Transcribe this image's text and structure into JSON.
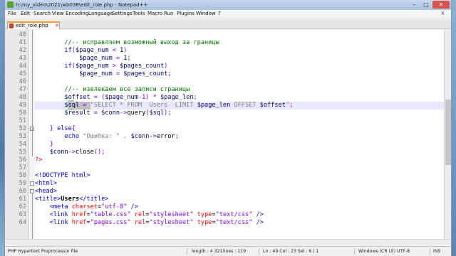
{
  "window": {
    "title": "h:\\my_video\\2021\\wb038\\edit_role.php - Notepad++",
    "controls": {
      "minimize": "–",
      "maximize": "□",
      "close": "✕"
    }
  },
  "menubar": {
    "items": [
      "File",
      "Edit",
      "Search",
      "View",
      "Encoding",
      "Language",
      "Settings",
      "Tools",
      "Macro",
      "Run",
      "Plugins",
      "Window",
      "?"
    ],
    "close_doc": "X"
  },
  "tabs": [
    {
      "label": "edit_role.php",
      "close": "✕",
      "active": true
    }
  ],
  "editor": {
    "lines": [
      {
        "n": "40",
        "tokens": []
      },
      {
        "n": "41",
        "tokens": [
          {
            "t": "        "
          },
          {
            "t": "//-- исправляем возможный выход за границы",
            "c": "cm"
          }
        ]
      },
      {
        "n": "42",
        "tokens": [
          {
            "t": "        "
          },
          {
            "t": "if",
            "c": "kw"
          },
          {
            "t": "(",
            "c": "op"
          },
          {
            "t": "$page_num",
            "c": "var"
          },
          {
            "t": " < ",
            "c": "op"
          },
          {
            "t": "1",
            "c": "fn"
          },
          {
            "t": ")",
            "c": "op"
          }
        ]
      },
      {
        "n": "43",
        "tokens": [
          {
            "t": "            "
          },
          {
            "t": "$page_num",
            "c": "var"
          },
          {
            "t": " = ",
            "c": "op"
          },
          {
            "t": "1",
            "c": "fn"
          },
          {
            "t": ";",
            "c": "op"
          }
        ]
      },
      {
        "n": "44",
        "tokens": [
          {
            "t": "        "
          },
          {
            "t": "if",
            "c": "kw"
          },
          {
            "t": "(",
            "c": "op"
          },
          {
            "t": "$page_num",
            "c": "var"
          },
          {
            "t": " > ",
            "c": "op"
          },
          {
            "t": "$pages_count",
            "c": "var"
          },
          {
            "t": ")",
            "c": "op"
          }
        ]
      },
      {
        "n": "45",
        "tokens": [
          {
            "t": "            "
          },
          {
            "t": "$page_num",
            "c": "var"
          },
          {
            "t": " = ",
            "c": "op"
          },
          {
            "t": "$pages_count",
            "c": "var"
          },
          {
            "t": ";",
            "c": "op"
          }
        ]
      },
      {
        "n": "46",
        "tokens": []
      },
      {
        "n": "47",
        "tokens": [
          {
            "t": "        "
          },
          {
            "t": "//-- извлекаем все записи страницы",
            "c": "cm"
          }
        ]
      },
      {
        "n": "48",
        "tokens": [
          {
            "t": "        "
          },
          {
            "t": "$offset",
            "c": "var"
          },
          {
            "t": " = (",
            "c": "op"
          },
          {
            "t": "$page_num",
            "c": "var"
          },
          {
            "t": "-1) * ",
            "c": "op"
          },
          {
            "t": "$page_len",
            "c": "var"
          },
          {
            "t": ";",
            "c": "op"
          }
        ]
      },
      {
        "n": "49",
        "tokens": [
          {
            "t": "        "
          },
          {
            "t": "$sql",
            "c": "var"
          },
          {
            "t": " = ",
            "c": "op"
          },
          {
            "t": "\"SELECT * FROM  Users  LIMIT ",
            "c": "str"
          },
          {
            "t": "$page_len",
            "c": "var"
          },
          {
            "t": " OFFSET ",
            "c": "str"
          },
          {
            "t": "$offset",
            "c": "var"
          },
          {
            "t": "\"",
            "c": "str"
          },
          {
            "t": ";",
            "c": "op"
          }
        ]
      },
      {
        "n": "50",
        "tokens": [
          {
            "t": "        "
          },
          {
            "t": "$result",
            "c": "var"
          },
          {
            "t": " = ",
            "c": "op"
          },
          {
            "t": "$conn",
            "c": "var"
          },
          {
            "t": "->",
            "c": "op"
          },
          {
            "t": "query",
            "c": "fn"
          },
          {
            "t": "(",
            "c": "op"
          },
          {
            "t": "$sql",
            "c": "var"
          },
          {
            "t": ");",
            "c": "op"
          }
        ]
      },
      {
        "n": "51",
        "tokens": []
      },
      {
        "n": "52",
        "tokens": [
          {
            "t": "    "
          },
          {
            "t": "} ",
            "c": "op"
          },
          {
            "t": "else",
            "c": "kw"
          },
          {
            "t": "{",
            "c": "op"
          }
        ]
      },
      {
        "n": "53",
        "tokens": [
          {
            "t": "        "
          },
          {
            "t": "echo",
            "c": "kw"
          },
          {
            "t": " ",
            "c": "op"
          },
          {
            "t": "\"Ошибка: \"",
            "c": "str"
          },
          {
            "t": " . ",
            "c": "op"
          },
          {
            "t": "$conn",
            "c": "var"
          },
          {
            "t": "->",
            "c": "op"
          },
          {
            "t": "error",
            "c": "fn"
          },
          {
            "t": ";",
            "c": "op"
          }
        ]
      },
      {
        "n": "54",
        "tokens": [
          {
            "t": "    "
          },
          {
            "t": "}",
            "c": "op"
          }
        ]
      },
      {
        "n": "55",
        "tokens": [
          {
            "t": "    "
          },
          {
            "t": "$conn",
            "c": "var"
          },
          {
            "t": "->",
            "c": "op"
          },
          {
            "t": "close",
            "c": "fn"
          },
          {
            "t": "();",
            "c": "op"
          }
        ]
      },
      {
        "n": "56",
        "tokens": [
          {
            "t": "?>",
            "c": "php"
          }
        ]
      },
      {
        "n": "57",
        "tokens": []
      },
      {
        "n": "58",
        "tokens": [
          {
            "t": "<!DOCTYPE html>",
            "c": "tag"
          }
        ]
      },
      {
        "n": "59",
        "tokens": [
          {
            "t": "<html>",
            "c": "tag"
          }
        ]
      },
      {
        "n": "60",
        "tokens": [
          {
            "t": "<head>",
            "c": "tag"
          }
        ]
      },
      {
        "n": "61",
        "tokens": [
          {
            "t": "<title>",
            "c": "tag"
          },
          {
            "t": "Users",
            "c": "bold"
          },
          {
            "t": "</title>",
            "c": "tag"
          }
        ]
      },
      {
        "n": "62",
        "tokens": [
          {
            "t": "    "
          },
          {
            "t": "<meta ",
            "c": "tag"
          },
          {
            "t": "charset",
            "c": "attr"
          },
          {
            "t": "=",
            "c": "fn"
          },
          {
            "t": "\"utf-8\"",
            "c": "aval"
          },
          {
            "t": " />",
            "c": "tag"
          }
        ]
      },
      {
        "n": "63",
        "tokens": [
          {
            "t": "    "
          },
          {
            "t": "<link ",
            "c": "tag"
          },
          {
            "t": "href",
            "c": "attr"
          },
          {
            "t": "=",
            "c": "fn"
          },
          {
            "t": "\"table.css\"",
            "c": "aval"
          },
          {
            "t": " ",
            "c": "fn"
          },
          {
            "t": "rel",
            "c": "attr"
          },
          {
            "t": "=",
            "c": "fn"
          },
          {
            "t": "\"stylesheet\"",
            "c": "aval"
          },
          {
            "t": " ",
            "c": "fn"
          },
          {
            "t": "type",
            "c": "attr"
          },
          {
            "t": "=",
            "c": "fn"
          },
          {
            "t": "\"text/css\"",
            "c": "aval"
          },
          {
            "t": " />",
            "c": "tag"
          }
        ]
      },
      {
        "n": "64",
        "tokens": [
          {
            "t": "    "
          },
          {
            "t": "<link ",
            "c": "tag"
          },
          {
            "t": "href",
            "c": "attr"
          },
          {
            "t": "=",
            "c": "fn"
          },
          {
            "t": "\"pages.css\"",
            "c": "aval"
          },
          {
            "t": " ",
            "c": "fn"
          },
          {
            "t": "rel",
            "c": "attr"
          },
          {
            "t": "=",
            "c": "fn"
          },
          {
            "t": "\"stylesheet\"",
            "c": "aval"
          },
          {
            "t": " ",
            "c": "fn"
          },
          {
            "t": "type",
            "c": "attr"
          },
          {
            "t": "=",
            "c": "fn"
          },
          {
            "t": "\"text/css\"",
            "c": "aval"
          },
          {
            "t": " />",
            "c": "tag"
          }
        ]
      }
    ]
  },
  "statusbar": {
    "language": "PHP Hypertext Preprocessor file",
    "length": "length : 4 321",
    "lines": "lines : 119",
    "position": "Ln : 49    Col : 23    Sel : 6 | 1",
    "eol": "Windows (CR LF)",
    "encoding": "UTF-8",
    "mode": "INS"
  }
}
